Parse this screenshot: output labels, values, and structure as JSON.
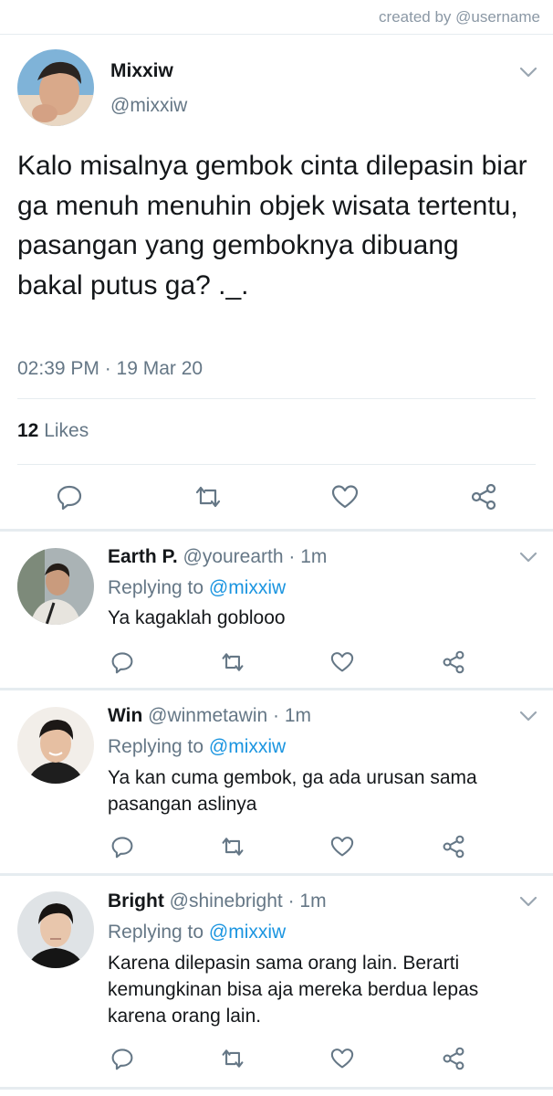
{
  "credit": "created by @username",
  "main_tweet": {
    "name": "Mixxiw",
    "handle": "@mixxiw",
    "text": "Kalo misalnya gembok cinta dilepasin biar ga menuh menuhin objek wisata tertentu, pasangan yang gemboknya dibuang bakal putus ga? ._.",
    "timestamp": "02:39 PM · 19 Mar 20",
    "likes_count": "12",
    "likes_label": "Likes"
  },
  "replies": [
    {
      "name": "Earth P.",
      "handle": "@yourearth",
      "time": "· 1m",
      "replying_label": "Replying to",
      "replying_to": "@mixxiw",
      "text": "Ya kagaklah goblooo"
    },
    {
      "name": "Win",
      "handle": "@winmetawin",
      "time": "· 1m",
      "replying_label": "Replying to",
      "replying_to": "@mixxiw",
      "text": "Ya kan cuma gembok, ga ada urusan sama pasangan aslinya"
    },
    {
      "name": "Bright",
      "handle": "@shinebright",
      "time": "· 1m",
      "replying_label": "Replying to",
      "replying_to": "@mixxiw",
      "text": "Karena dilepasin sama orang lain. Berarti kemungkinan bisa aja mereka berdua lepas karena orang lain."
    }
  ],
  "icons": {
    "reply": "reply-icon",
    "retweet": "retweet-icon",
    "like": "heart-icon",
    "share": "share-icon",
    "more": "chevron-down-icon"
  },
  "colors": {
    "text": "#14171a",
    "secondary": "#657786",
    "link": "#1b95e0",
    "divider": "#e6ecf0"
  }
}
